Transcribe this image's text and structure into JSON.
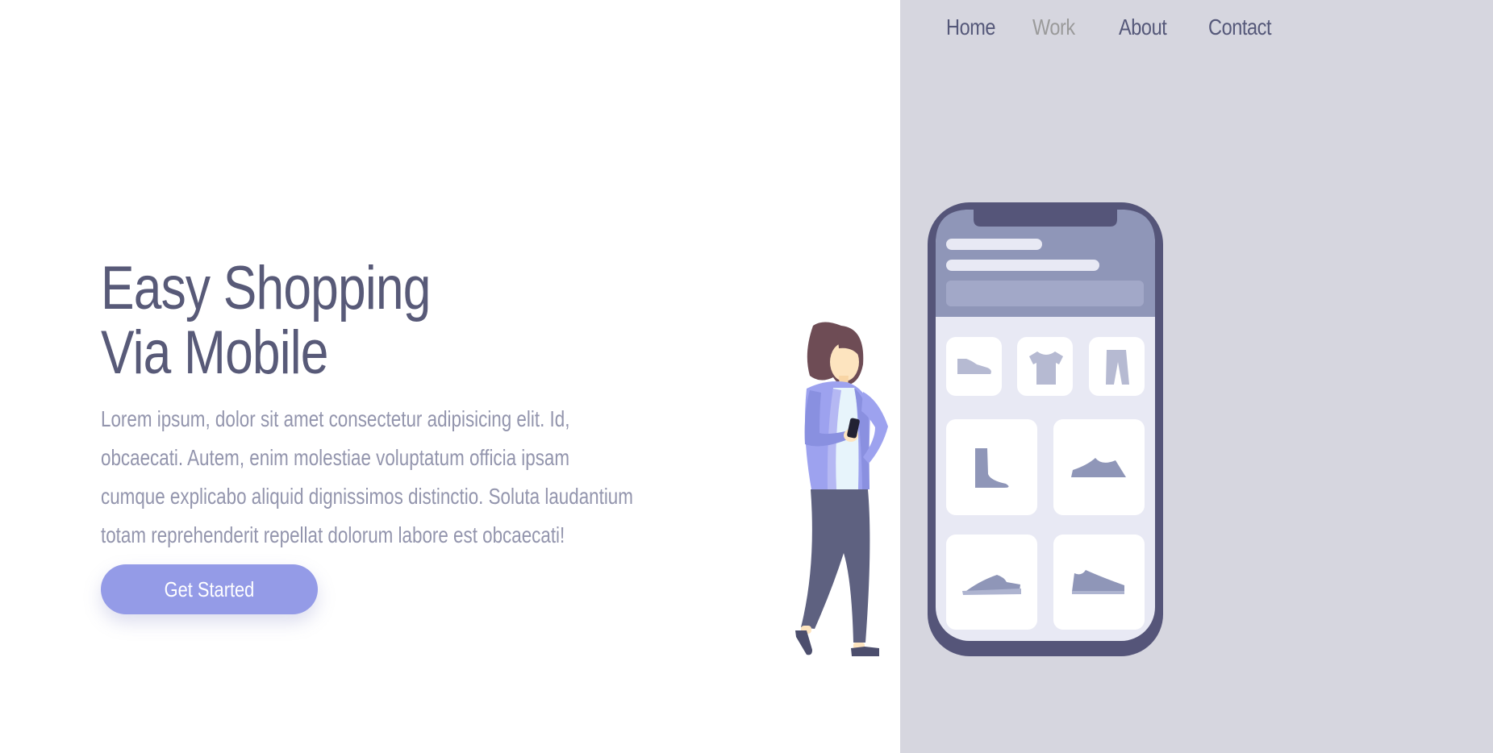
{
  "nav": {
    "items": [
      "Home",
      "Work",
      "About",
      "Contact"
    ]
  },
  "hero": {
    "title_line1": "Easy Shopping",
    "title_line2": "Via Mobile",
    "body": "Lorem ipsum, dolor sit amet consectetur adipisicing elit. Id, obcaecati. Autem, enim molestiae voluptatum officia ipsam cumque explicabo aliquid dignissimos distinctio. Soluta laudantium totam reprehenderit repellat dolorum labore est obcaecati!",
    "cta_label": "Get Started"
  },
  "colors": {
    "panel_bg": "#d6d6df",
    "title": "#585a78",
    "body_text": "#9395ad",
    "accent": "#949be7",
    "nav_active": "#9a9a9a",
    "nav": "#555879"
  },
  "illustration": {
    "icons": [
      "woman-icon",
      "smartphone-icon",
      "shoe-icon",
      "tshirt-icon",
      "pants-icon",
      "boot-icon",
      "sneaker-icon"
    ]
  }
}
